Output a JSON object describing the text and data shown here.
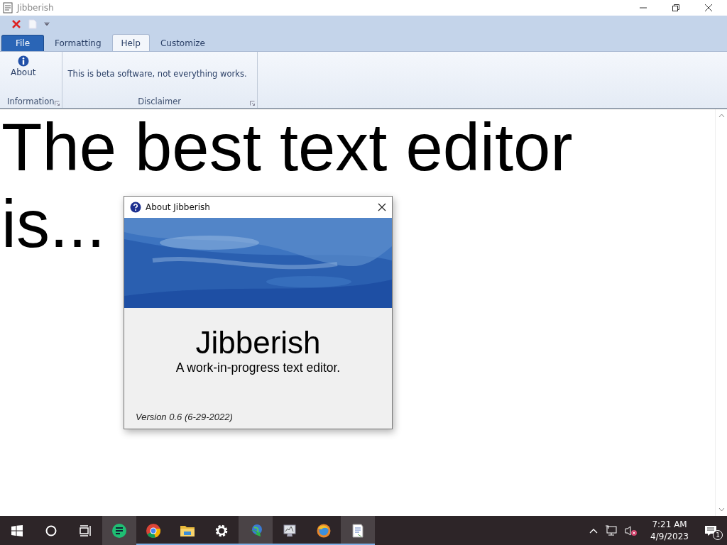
{
  "window": {
    "title": "Jibberish"
  },
  "tabs": [
    {
      "label": "File",
      "kind": "file",
      "selected": false
    },
    {
      "label": "Formatting",
      "kind": "tab",
      "selected": false
    },
    {
      "label": "Help",
      "kind": "tab",
      "selected": true
    },
    {
      "label": "Customize",
      "kind": "tab",
      "selected": false
    }
  ],
  "ribbon": {
    "groups": [
      {
        "label": "Information",
        "items": [
          {
            "kind": "button",
            "label": "About"
          }
        ]
      },
      {
        "label": "Disclaimer",
        "items": [
          {
            "kind": "text",
            "label": "This is beta software, not everything works."
          }
        ]
      }
    ]
  },
  "document": {
    "lines": [
      "The best text editor",
      "is..."
    ]
  },
  "dialog": {
    "title": "About Jibberish",
    "app_name": "Jibberish",
    "tagline": "A work-in-progress text editor.",
    "version": "Version 0.6 (6-29-2022)"
  },
  "taskbar": {
    "apps": [
      {
        "kind": "chat",
        "running": false,
        "selected": true
      },
      {
        "kind": "chrome",
        "running": true,
        "selected": false
      },
      {
        "kind": "folder",
        "running": true,
        "selected": false
      },
      {
        "kind": "gear",
        "running": true,
        "selected": false
      },
      {
        "kind": "globe",
        "running": true,
        "selected": true
      },
      {
        "kind": "monitor",
        "running": true,
        "selected": false
      },
      {
        "kind": "browser",
        "running": true,
        "selected": false
      },
      {
        "kind": "notepad",
        "running": true,
        "selected": true
      }
    ],
    "time": "7:21 AM",
    "date": "4/9/2023",
    "notifications": "1"
  }
}
